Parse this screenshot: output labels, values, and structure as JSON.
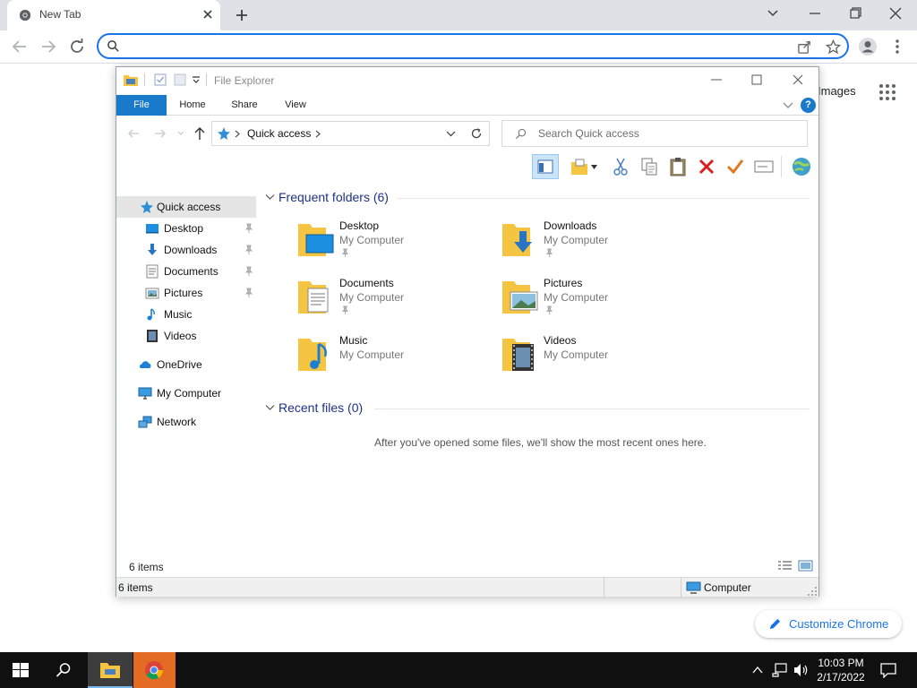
{
  "chrome": {
    "tab_title": "New Tab",
    "omnibox_value": "",
    "ntp_images_link": "Images",
    "customize_label": "Customize Chrome"
  },
  "explorer": {
    "title": "File Explorer",
    "ribbon_tabs": [
      "File",
      "Home",
      "Share",
      "View"
    ],
    "breadcrumb": "Quick access",
    "search_placeholder": "Search Quick access",
    "nav_items": [
      {
        "label": "Quick access",
        "icon": "star-icon",
        "pinned": false
      },
      {
        "label": "Desktop",
        "icon": "desktop-icon",
        "pinned": true
      },
      {
        "label": "Downloads",
        "icon": "download-icon",
        "pinned": true
      },
      {
        "label": "Documents",
        "icon": "documents-icon",
        "pinned": true
      },
      {
        "label": "Pictures",
        "icon": "pictures-icon",
        "pinned": true
      },
      {
        "label": "Music",
        "icon": "music-icon",
        "pinned": false
      },
      {
        "label": "Videos",
        "icon": "videos-icon",
        "pinned": false
      },
      {
        "label": "OneDrive",
        "icon": "cloud-icon",
        "pinned": false
      },
      {
        "label": "My Computer",
        "icon": "computer-icon",
        "pinned": false
      },
      {
        "label": "Network",
        "icon": "network-icon",
        "pinned": false
      }
    ],
    "frequent_header": "Frequent folders (6)",
    "folders": [
      {
        "name": "Desktop",
        "location": "My Computer",
        "pinned": true
      },
      {
        "name": "Downloads",
        "location": "My Computer",
        "pinned": true
      },
      {
        "name": "Documents",
        "location": "My Computer",
        "pinned": true
      },
      {
        "name": "Pictures",
        "location": "My Computer",
        "pinned": true
      },
      {
        "name": "Music",
        "location": "My Computer",
        "pinned": false
      },
      {
        "name": "Videos",
        "location": "My Computer",
        "pinned": false
      }
    ],
    "recent_header": "Recent files (0)",
    "recent_empty_text": "After you've opened some files, we'll show the most recent ones here.",
    "item_count": "6 items",
    "status_count": "6 items",
    "status_location": "Computer"
  },
  "taskbar": {
    "time": "10:03 PM",
    "date": "2/17/2022"
  },
  "colors": {
    "accent": "#1a73e8",
    "file_tab": "#1979ca",
    "folder_yellow": "#f5c542",
    "group_header": "#1e3287"
  }
}
